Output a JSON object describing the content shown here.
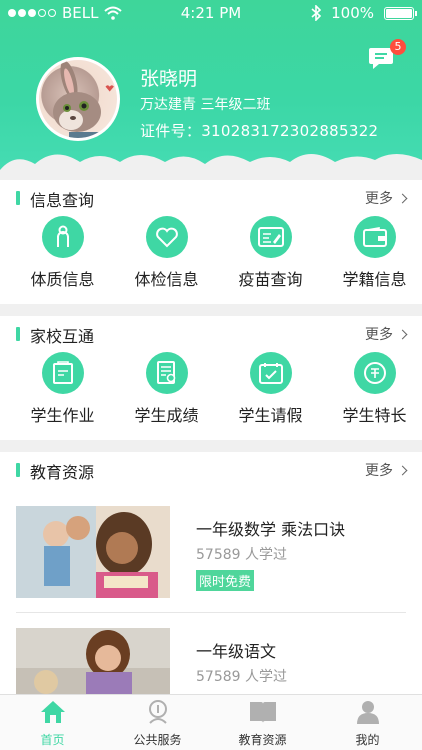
{
  "status": {
    "carrier": "BELL",
    "time": "4:21 PM",
    "battery": "100%"
  },
  "profile": {
    "name": "张晓明",
    "school": "万达建青 三年级二班",
    "id": "证件号：310283172302885322"
  },
  "messages": {
    "badge": "5"
  },
  "sections": {
    "info": {
      "title": "信息查询",
      "more": "更多",
      "items": [
        "体质信息",
        "体检信息",
        "疫苗查询",
        "学籍信息"
      ]
    },
    "home_school": {
      "title": "家校互通",
      "more": "更多",
      "items": [
        "学生作业",
        "学生成绩",
        "学生请假",
        "学生特长"
      ]
    },
    "resources": {
      "title": "教育资源",
      "more": "更多",
      "items": [
        {
          "title": "一年级数学 乘法口诀",
          "meta": "57589 人学过",
          "tag": "限时免费"
        },
        {
          "title": "一年级语文",
          "meta": "57589 人学过"
        }
      ]
    }
  },
  "tabbar": {
    "items": [
      "首页",
      "公共服务",
      "教育资源",
      "我的"
    ],
    "active": "首页"
  },
  "colors": {
    "accent": "#3fd7a4",
    "badge": "#ff4d3d",
    "tag": "#4fd69b"
  },
  "icons": {
    "info": [
      "person-icon",
      "heart-icon",
      "vaccine-card-icon",
      "wallet-icon"
    ],
    "home_school": [
      "homework-icon",
      "grades-icon",
      "calendar-icon",
      "specialty-icon"
    ],
    "tabbar": [
      "home-icon",
      "public-service-icon",
      "book-icon",
      "user-icon"
    ]
  }
}
